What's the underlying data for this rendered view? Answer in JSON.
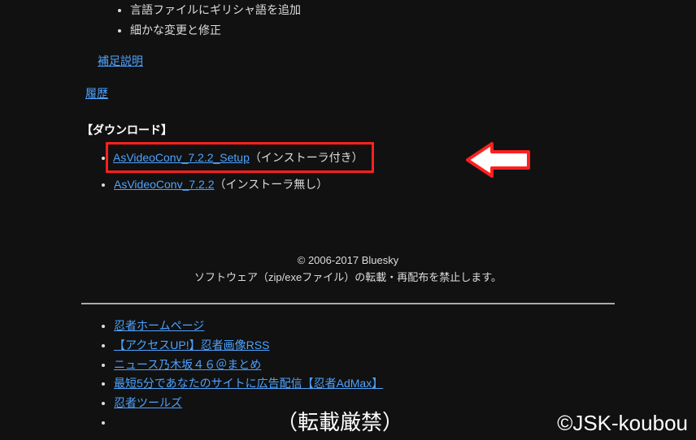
{
  "changelog": {
    "items": [
      "言語ファイルにギリシャ語を追加",
      "細かな変更と修正"
    ]
  },
  "supplemental_note_link": "補足説明",
  "history_link": "履歴",
  "download": {
    "heading": "【ダウンロード】",
    "items": [
      {
        "link": "AsVideoConv_7.2.2_Setup",
        "note": "（インストーラ付き）",
        "highlighted": true
      },
      {
        "link": "AsVideoConv_7.2.2",
        "note": "（インストーラ無し）",
        "highlighted": false
      }
    ]
  },
  "footer": {
    "copyright": "© 2006-2017 Bluesky",
    "notice": "ソフトウェア（zip/exeファイル）の転載・再配布を禁止します。",
    "links": [
      "忍者ホームページ",
      "【アクセスUP!】忍者画像RSS",
      "ニュース乃木坂４６＠まとめ",
      "最短5分であなたのサイトに広告配信【忍者AdMax】",
      "忍者ツールズ"
    ]
  },
  "watermark": {
    "left": "（転載厳禁）",
    "right": "©JSK-koubou"
  }
}
